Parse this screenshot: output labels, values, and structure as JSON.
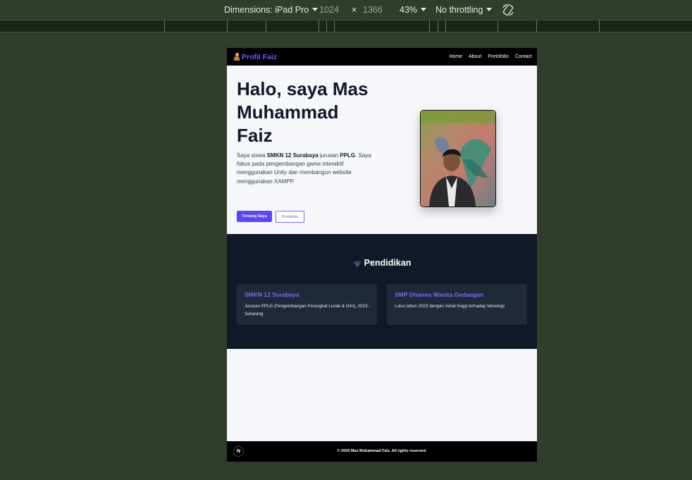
{
  "devtools": {
    "dimensions_label": "Dimensions: iPad Pro",
    "width": "1024",
    "times": "×",
    "height": "1366",
    "zoom": "43%",
    "throttling": "No throttling",
    "rotate_icon": "rotate-icon"
  },
  "site": {
    "brand": "Profil Faiz",
    "nav": [
      "Home",
      "About",
      "Portofolio",
      "Contact"
    ],
    "hero": {
      "title": "Halo, saya Mas Muhammad Faiz",
      "intro_pre": "Saya siswa ",
      "school": "SMKN 12 Surabaya",
      "intro_mid": " jurusan ",
      "major": "PPLG",
      "intro_post": ". Saya fokus pada pengembangan game interaktif menggunakan Unity dan membangun website menggunakan XAMPP.",
      "btn_primary": "Tentang Saya",
      "btn_secondary": "Portofolio"
    },
    "education": {
      "title": "Pendidikan",
      "cards": [
        {
          "name": "SMKN 12 Surabaya",
          "desc": "Jurusan PPLG (Pengembangan Perangkat Lunak & Gim), 2023 - Sekarang"
        },
        {
          "name": "SMP Dharma Wanita Gedangan",
          "desc": "Lulus tahun 2023 dengan minat tinggi terhadap teknologi"
        }
      ]
    },
    "footer": {
      "badge": "N",
      "copyright": "© 2025 Mas Muhammad Faiz. All rights reserved."
    }
  },
  "colors": {
    "accent": "#5b45f5",
    "dark_section": "#111827",
    "card": "#1f2937",
    "page_bg": "#2f3d2a"
  }
}
